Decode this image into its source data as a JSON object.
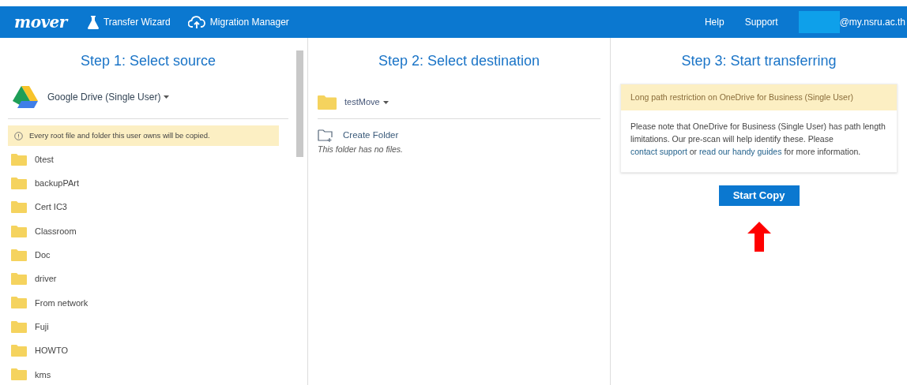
{
  "navbar": {
    "logo": "mover",
    "links": [
      {
        "label": "Transfer Wizard",
        "kind": "flask"
      },
      {
        "label": "Migration Manager",
        "kind": "cloud"
      }
    ],
    "right_links": [
      "Help",
      "Support"
    ],
    "account": "@my.nsru.ac.th"
  },
  "source": {
    "title": "Step 1: Select source",
    "connector": "Google Drive (Single User)",
    "notice": "Every root file and folder this user owns will be copied.",
    "folders": [
      "0test",
      "backupPArt",
      "Cert IC3",
      "Classroom",
      "Doc",
      "driver",
      "From network",
      "Fuji",
      "HOWTO",
      "kms"
    ]
  },
  "destination": {
    "title": "Step 2: Select destination",
    "folder": "testMove",
    "create_folder": "Create Folder",
    "empty_message": "This folder has no files."
  },
  "transfer": {
    "title": "Step 3: Start transferring",
    "alert_title": "Long path restriction on OneDrive for Business (Single User)",
    "alert_body": [
      {
        "kind": "text",
        "text": "Please note that OneDrive for Business (Single User) has path length limitations. Our pre-scan will help identify these. Please "
      },
      {
        "kind": "link",
        "text": "contact support"
      },
      {
        "kind": "text",
        "text": " or "
      },
      {
        "kind": "link",
        "text": "read our handy guides"
      },
      {
        "kind": "text",
        "text": " for more information."
      }
    ],
    "button": "Start Copy"
  }
}
